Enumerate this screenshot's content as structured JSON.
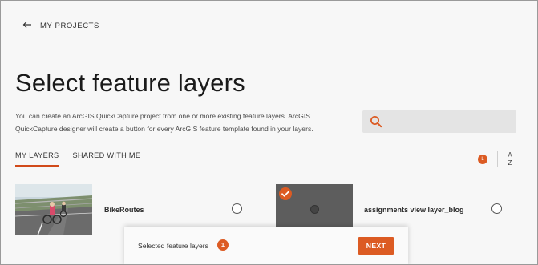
{
  "nav": {
    "back_label": "MY PROJECTS",
    "back_icon": "arrow-left-icon"
  },
  "header": {
    "title": "Select feature layers",
    "description": "You can create an ArcGIS QuickCapture project from one or more existing feature layers. ArcGIS QuickCapture designer will create a button for every ArcGIS feature template found in your layers."
  },
  "search": {
    "placeholder": "",
    "icon": "search-icon"
  },
  "tabs": [
    {
      "label": "MY LAYERS",
      "active": true
    },
    {
      "label": "SHARED WITH ME",
      "active": false
    }
  ],
  "sort": {
    "recent_icon": "recent-sort-icon",
    "recent_glyph": "L",
    "az_top": "A",
    "az_bottom": "Z"
  },
  "layers": [
    {
      "name": "BikeRoutes",
      "selected": false
    },
    {
      "name": "assignments view layer_blog",
      "selected": true
    }
  ],
  "selection_bar": {
    "label": "Selected feature layers",
    "count": "1",
    "next_label": "NEXT"
  },
  "colors": {
    "accent": "#dc5b23",
    "selected_thumb": "#5d5d5d",
    "background": "#f7f7f7"
  }
}
